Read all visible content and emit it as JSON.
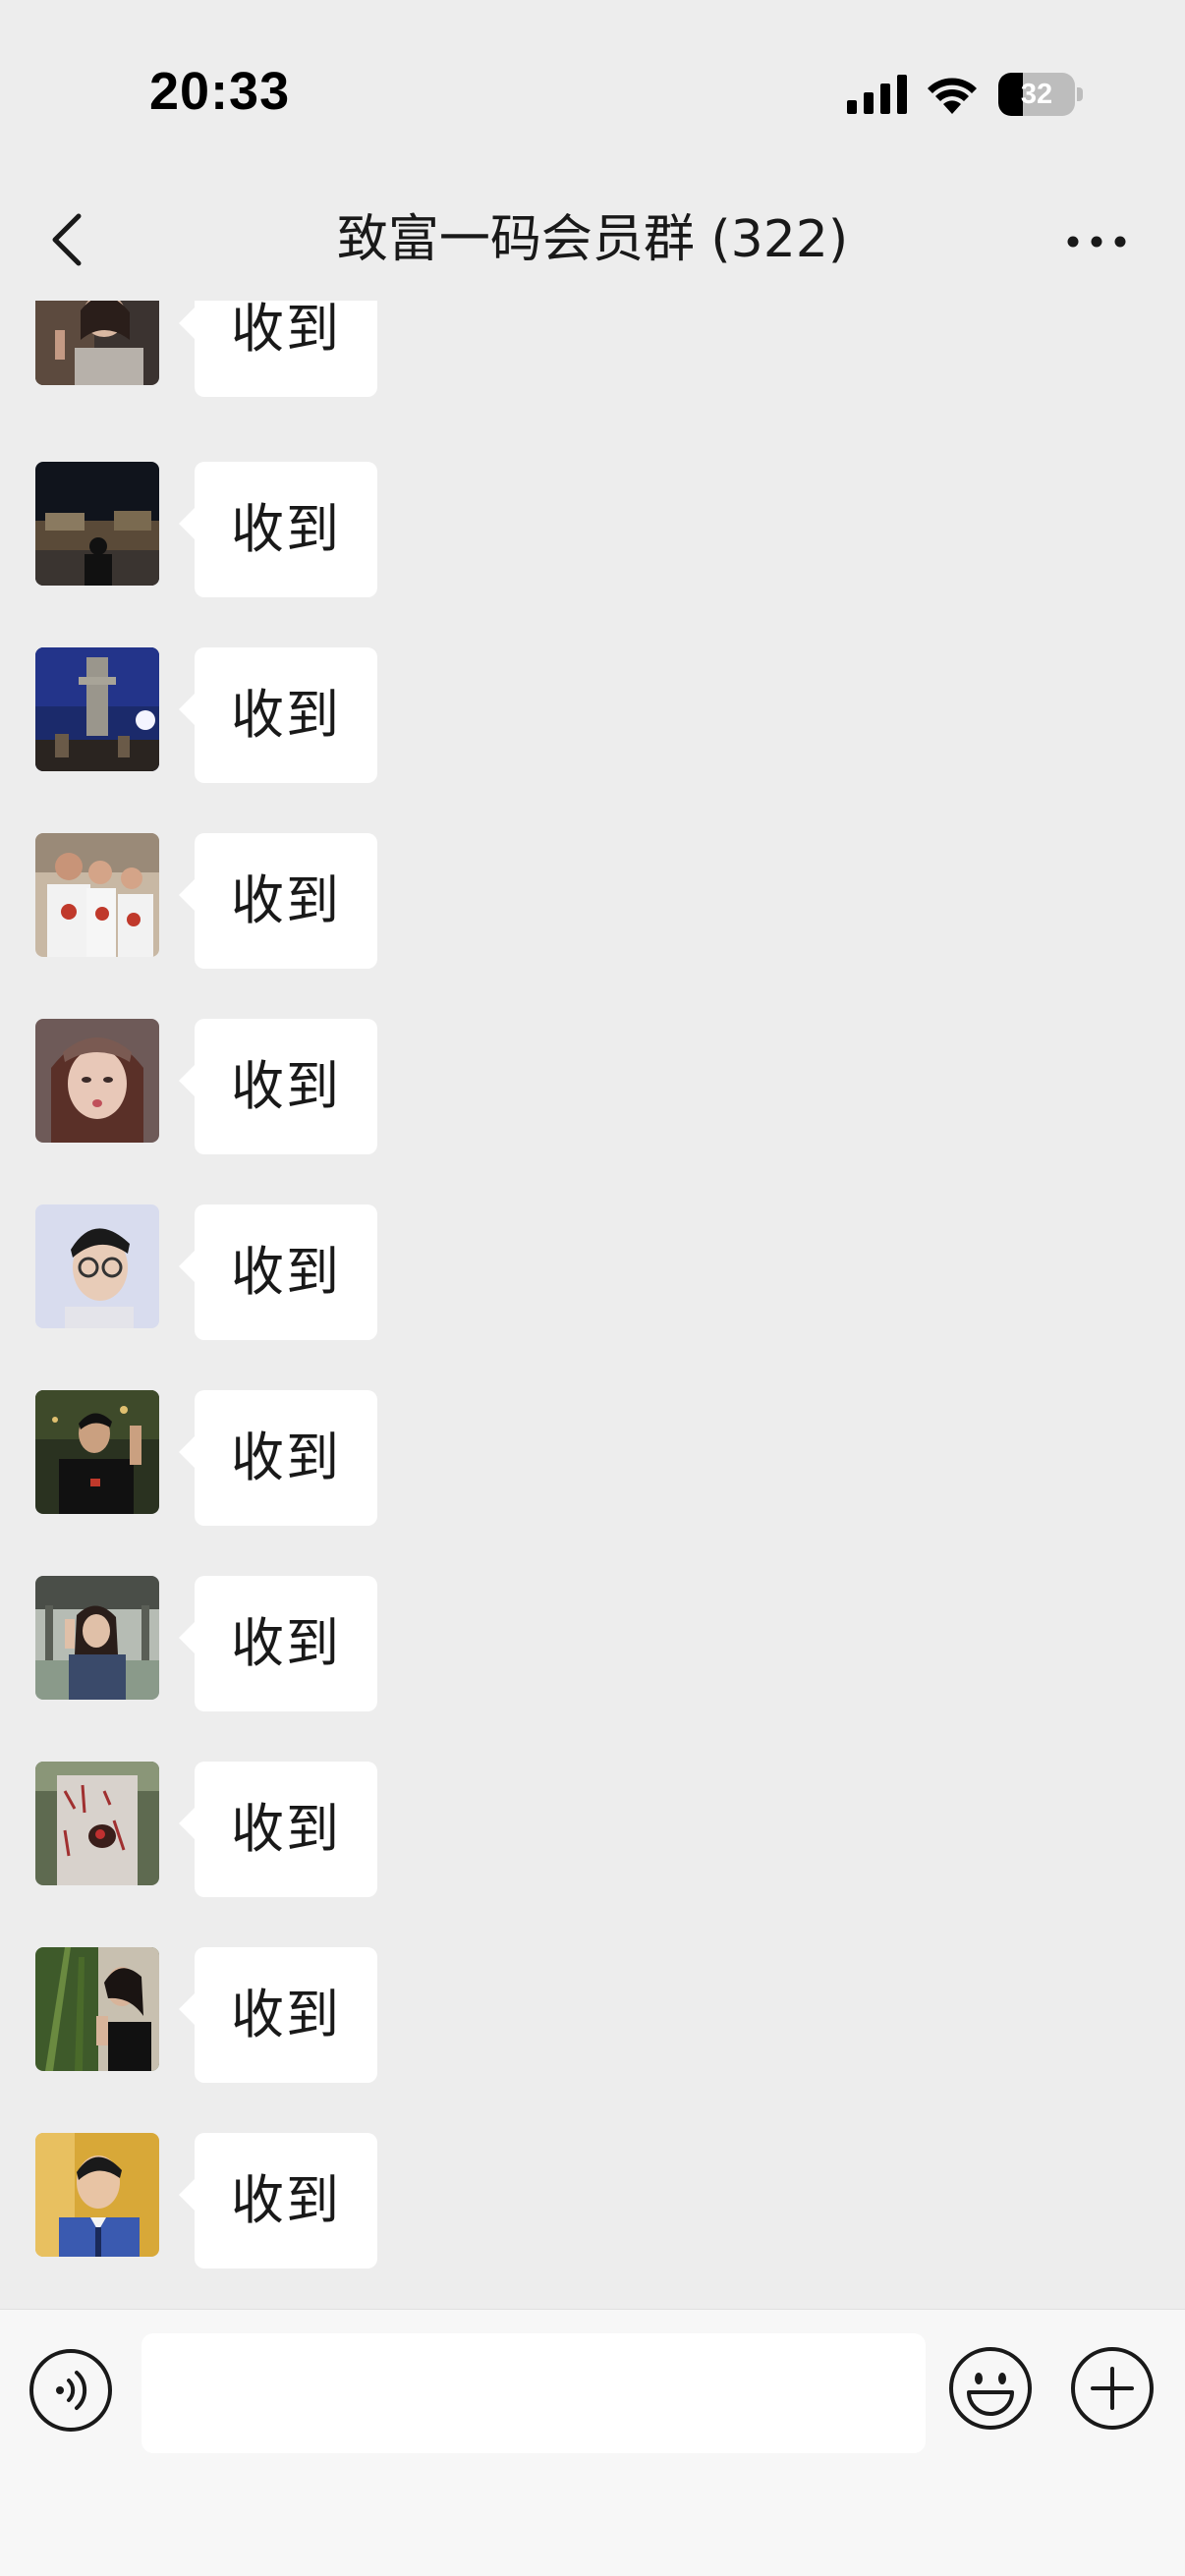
{
  "status_bar": {
    "time": "20:33",
    "battery_level": "32"
  },
  "nav": {
    "title": "致富一码会员群 (322)"
  },
  "messages": [
    {
      "text": "收到"
    },
    {
      "text": "收到"
    },
    {
      "text": "收到"
    },
    {
      "text": "收到"
    },
    {
      "text": "收到"
    },
    {
      "text": "收到"
    },
    {
      "text": "收到"
    },
    {
      "text": "收到"
    },
    {
      "text": "收到"
    },
    {
      "text": "收到"
    },
    {
      "text": "收到"
    }
  ],
  "input": {
    "value": "",
    "placeholder": ""
  },
  "icons": {
    "back": "chevron-left-icon",
    "more": "more-dots-icon",
    "voice": "voice-icon",
    "emoji": "emoji-icon",
    "plus": "plus-circle-icon"
  },
  "colors": {
    "background": "#ededed",
    "bubble": "#ffffff",
    "input_bar": "#f7f7f7",
    "text": "#191919"
  }
}
